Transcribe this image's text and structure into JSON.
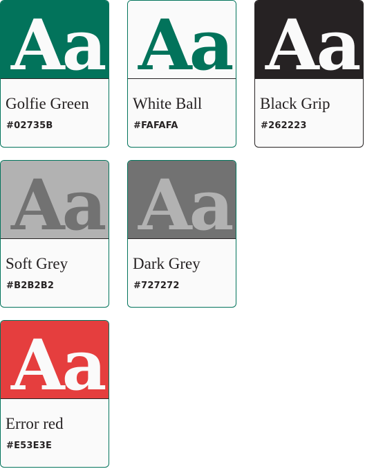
{
  "swatches": [
    {
      "sample": "Aa",
      "name": "Golfie Green",
      "hex": "#02735B",
      "bg": "#02735B",
      "fg": "#FAFAFA",
      "border": "#02735B"
    },
    {
      "sample": "Aa",
      "name": "White Ball",
      "hex": "#FAFAFA",
      "bg": "#FAFAFA",
      "fg": "#02735B",
      "border": "#02735B"
    },
    {
      "sample": "Aa",
      "name": "Black Grip",
      "hex": "#262223",
      "bg": "#262223",
      "fg": "#FAFAFA",
      "border": "#262223"
    },
    {
      "sample": "Aa",
      "name": "Soft Grey",
      "hex": "#B2B2B2",
      "bg": "#B2B2B2",
      "fg": "#727272",
      "border": "#02735B"
    },
    {
      "sample": "Aa",
      "name": "Dark Grey",
      "hex": "#727272",
      "bg": "#727272",
      "fg": "#B2B2B2",
      "border": "#02735B"
    },
    {
      "sample": "Aa",
      "name": "Error red",
      "hex": "#E53E3E",
      "bg": "#E53E3E",
      "fg": "#FAFAFA",
      "border": "#02735B"
    }
  ]
}
